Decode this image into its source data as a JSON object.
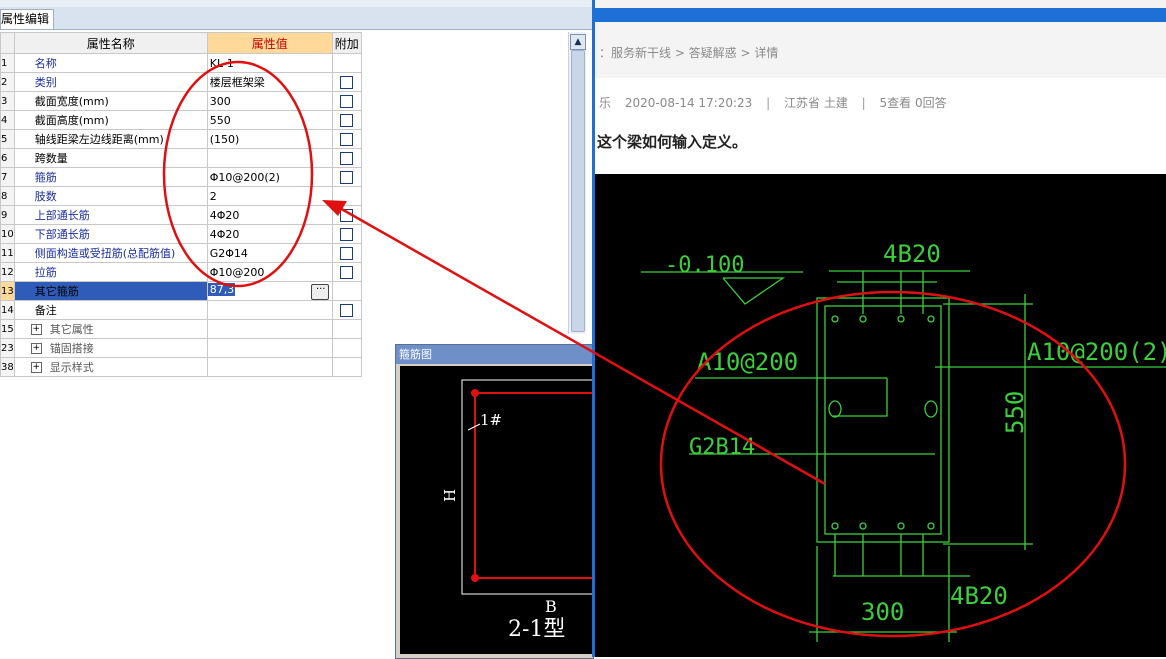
{
  "left_panel": {
    "tab_label": "属性编辑",
    "columns": {
      "name": "属性名称",
      "value": "属性值",
      "extra": "附加"
    },
    "rows": [
      {
        "num": "1",
        "name": "名称",
        "value": "KL-1",
        "checkbox": false,
        "style": "blue"
      },
      {
        "num": "2",
        "name": "类别",
        "value": "楼层框架梁",
        "checkbox": true,
        "style": "blue"
      },
      {
        "num": "3",
        "name": "截面宽度(mm)",
        "value": "300",
        "checkbox": true,
        "style": "black"
      },
      {
        "num": "4",
        "name": "截面高度(mm)",
        "value": "550",
        "checkbox": true,
        "style": "black"
      },
      {
        "num": "5",
        "name": "轴线距梁左边线距离(mm)",
        "value": "(150)",
        "checkbox": true,
        "style": "black"
      },
      {
        "num": "6",
        "name": "跨数量",
        "value": "",
        "checkbox": true,
        "style": "black"
      },
      {
        "num": "7",
        "name": "箍筋",
        "value": "Φ10@200(2)",
        "checkbox": true,
        "style": "blue"
      },
      {
        "num": "8",
        "name": "肢数",
        "value": "2",
        "checkbox": false,
        "style": "blue"
      },
      {
        "num": "9",
        "name": "上部通长筋",
        "value": "4Φ20",
        "checkbox": true,
        "style": "blue"
      },
      {
        "num": "10",
        "name": "下部通长筋",
        "value": "4Φ20",
        "checkbox": true,
        "style": "blue"
      },
      {
        "num": "11",
        "name": "侧面构造或受扭筋(总配筋值)",
        "value": "G2Φ14",
        "checkbox": true,
        "style": "blue"
      },
      {
        "num": "12",
        "name": "拉筋",
        "value": "Φ10@200",
        "checkbox": true,
        "style": "blue"
      },
      {
        "num": "13",
        "name": "其它箍筋",
        "value": "87,3",
        "checkbox": false,
        "style": "selected"
      },
      {
        "num": "14",
        "name": "备注",
        "value": "",
        "checkbox": true,
        "style": "black"
      },
      {
        "num": "15",
        "name": "其它属性",
        "value": "",
        "checkbox": false,
        "style": "group"
      },
      {
        "num": "23",
        "name": "锚固搭接",
        "value": "",
        "checkbox": false,
        "style": "group"
      },
      {
        "num": "38",
        "name": "显示样式",
        "value": "",
        "checkbox": false,
        "style": "group"
      }
    ]
  },
  "dialog": {
    "title": "箍筋图",
    "label_1": "1#",
    "label_h": "H",
    "label_b": "B",
    "type_label": "2-1型"
  },
  "right_panel": {
    "breadcrumb": "：服务新干线 > 答疑解惑 > 详情",
    "meta_user": "乐",
    "meta_date": "2020-08-14 17:20:23",
    "meta_region": "江苏省  土建",
    "meta_stats": "5查看  0回答",
    "question_title": "这个梁如何输入定义。",
    "drawing": {
      "elevation": "-0.100",
      "top_bars": "4B20",
      "stirrup_left": "A10@200",
      "stirrup_right": "A10@200(2)",
      "side_bars": "G2B14",
      "height": "550",
      "width": "300",
      "bottom_bars": "4B20"
    }
  },
  "colors": {
    "cad_line": "#3ccf3c",
    "annotation_red": "#e01010",
    "header_value_bg": "#ffd99a",
    "selection_blue": "#2f5cb8"
  }
}
